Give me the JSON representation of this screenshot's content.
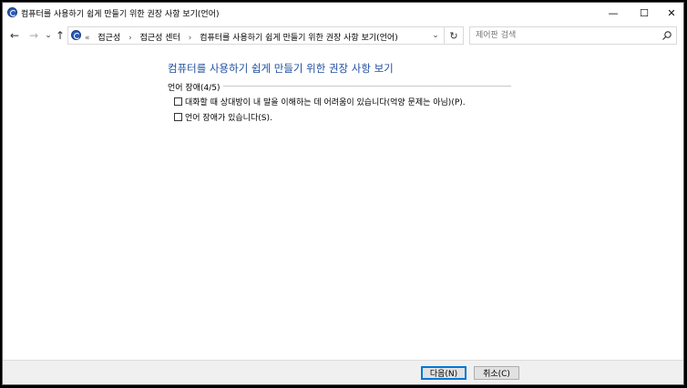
{
  "window": {
    "title": "컴퓨터를 사용하기 쉽게 만들기 위한 권장 사항 보기(언어)",
    "minimize": "—",
    "maximize": "☐",
    "close": "✕"
  },
  "nav": {
    "back": "←",
    "forward": "→",
    "recent": "⌄",
    "up": "↑",
    "breadcrumb": {
      "overflow": "«",
      "items": [
        "접근성",
        "접근성 센터",
        "컴퓨터를 사용하기 쉽게 만들기 위한 권장 사항 보기(언어)"
      ],
      "separator": "›"
    },
    "dropdown": "⌄",
    "refresh": "↻",
    "search_placeholder": "제어판 검색"
  },
  "main": {
    "heading": "컴퓨터를 사용하기 쉽게 만들기 위한 권장 사항 보기",
    "group_label": "언어 장애(4/5)",
    "options": [
      {
        "label": "대화할 때 상대방이 내 말을 이해하는 데 어려움이 있습니다(억양 문제는 아님)(P).",
        "checked": false
      },
      {
        "label": "언어 장애가 있습니다(S).",
        "checked": false
      }
    ]
  },
  "footer": {
    "next_label": "다음(N)",
    "cancel_label": "취소(C)"
  }
}
